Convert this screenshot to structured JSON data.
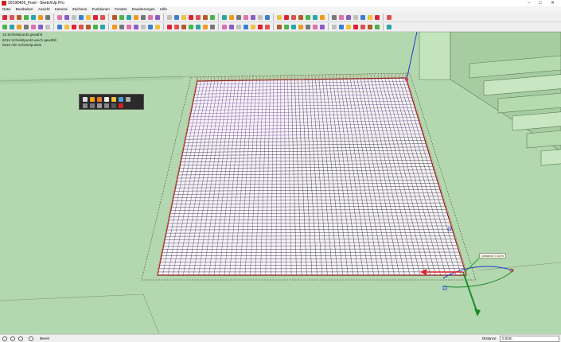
{
  "window": {
    "title": "20190426_Fisel - SketchUp Pro",
    "controls": [
      "–",
      "□",
      "✕"
    ]
  },
  "menu": [
    "Datei",
    "Bearbeiten",
    "Ansicht",
    "Kamera",
    "Zeichnen",
    "Funktionen",
    "Fenster",
    "Erweiterungen",
    "Hilfe"
  ],
  "toolbar_icons": {
    "row1": [
      "select-icon",
      "component-icon",
      "paint-bucket-icon",
      "eraser-icon",
      "line-icon",
      "arc-icon",
      "rectangle-icon",
      "circle-icon",
      "polygon-icon",
      "push-pull-icon",
      "move-icon",
      "rotate-icon",
      "scale-icon",
      "offset-icon",
      "tape-measure-icon",
      "text-icon",
      "axes-icon",
      "dimension-icon",
      "protractor-icon",
      "orbit-icon",
      "pan-icon",
      "zoom-icon",
      "zoom-window-icon",
      "zoom-extents-icon",
      "previous-view-icon",
      "iso-view-icon",
      "top-view-icon",
      "front-view-icon",
      "right-view-icon",
      "back-view-icon",
      "left-view-icon",
      "xray-icon",
      "wireframe-icon",
      "hidden-line-icon",
      "shaded-icon",
      "textured-icon",
      "monochrome-icon",
      "section-plane-icon",
      "section-display-icon",
      "warehouse-icon",
      "extension-icon",
      "layout-icon",
      "ruby-icon",
      "solid-tools-icon",
      "sandbox-icon",
      "outliner-icon",
      "styles-icon",
      "shadows-icon",
      "fog-icon",
      "match-photo-icon"
    ],
    "row2": [
      "plugin-1-icon",
      "plugin-2-icon",
      "plugin-3-icon",
      "plugin-4-icon",
      "plugin-5-icon",
      "plugin-6-icon",
      "plugin-7-icon",
      "plugin-8-icon",
      "plugin-9-icon",
      "plugin-10-icon",
      "plugin-11-icon",
      "plugin-12-icon",
      "plugin-13-icon",
      "plugin-14-icon",
      "plugin-15-icon",
      "plugin-16-icon",
      "plugin-17-icon",
      "plugin-18-icon",
      "plugin-19-icon",
      "plugin-20-icon",
      "plugin-21-icon",
      "plugin-22-icon",
      "plugin-23-icon",
      "plugin-24-icon",
      "plugin-25-icon",
      "plugin-26-icon",
      "plugin-27-icon",
      "plugin-28-icon",
      "plugin-29-icon",
      "plugin-30-icon",
      "plugin-31-icon",
      "plugin-32-icon",
      "plugin-33-icon",
      "plugin-34-icon",
      "plugin-35-icon",
      "plugin-36-icon",
      "plugin-37-icon",
      "plugin-38-icon",
      "plugin-39-icon",
      "plugin-40-icon",
      "plugin-41-icon",
      "plugin-42-icon",
      "plugin-43-icon",
      "plugin-44-icon",
      "plugin-45-icon",
      "plugin-46-icon",
      "plugin-47-icon",
      "plugin-48-icon",
      "plugin-49-icon",
      "plugin-50-icon"
    ]
  },
  "selection_info": [
    "16 Scheitelpunkt gewählt",
    "5016 Scheitelpunkt weich gewählt",
    "5610 Alle Scheitelpunkte"
  ],
  "tooltip": {
    "text": "Distance 0.02m"
  },
  "status": {
    "text": "Bereit",
    "vcb_label": "Distance",
    "vcb_value": "0,02m"
  },
  "colors": {
    "background": "#b3d7ae",
    "grid_line": "#2f2f2f",
    "accent_red": "#d22",
    "axis_blue": "#1a3cc8",
    "axis_green": "#1c8c2c"
  }
}
